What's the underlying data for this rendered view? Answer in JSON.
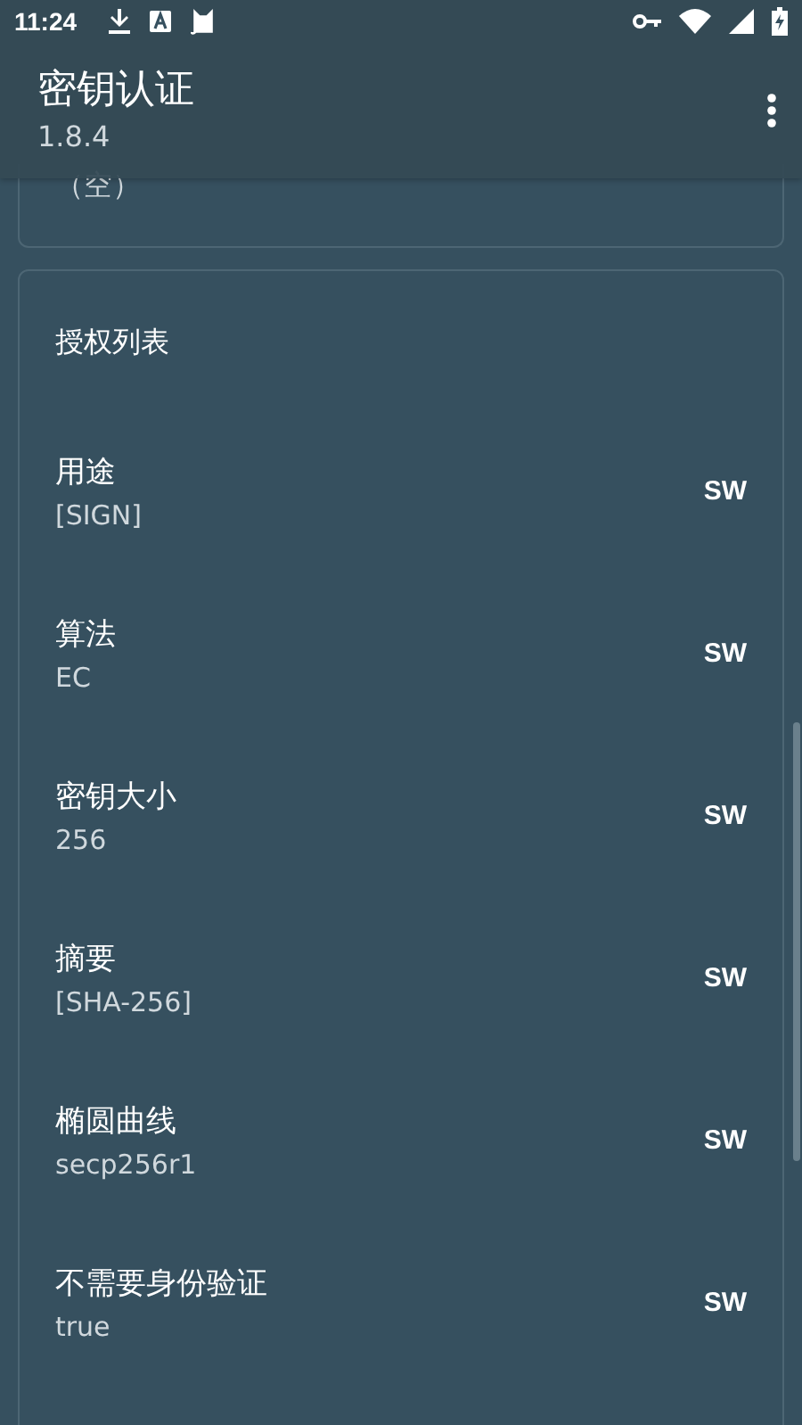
{
  "status_bar": {
    "time": "11:24"
  },
  "app_bar": {
    "title": "密钥认证",
    "subtitle": "1.8.4"
  },
  "top_card": {
    "value": "（空）"
  },
  "auth_card": {
    "title": "授权列表",
    "rows": [
      {
        "label": "用途",
        "value": "[SIGN]",
        "badge": "SW"
      },
      {
        "label": "算法",
        "value": "EC",
        "badge": "SW"
      },
      {
        "label": "密钥大小",
        "value": "256",
        "badge": "SW"
      },
      {
        "label": "摘要",
        "value": "[SHA-256]",
        "badge": "SW"
      },
      {
        "label": "椭圆曲线",
        "value": "secp256r1",
        "badge": "SW"
      },
      {
        "label": "不需要身份验证",
        "value": "true",
        "badge": "SW"
      }
    ]
  }
}
